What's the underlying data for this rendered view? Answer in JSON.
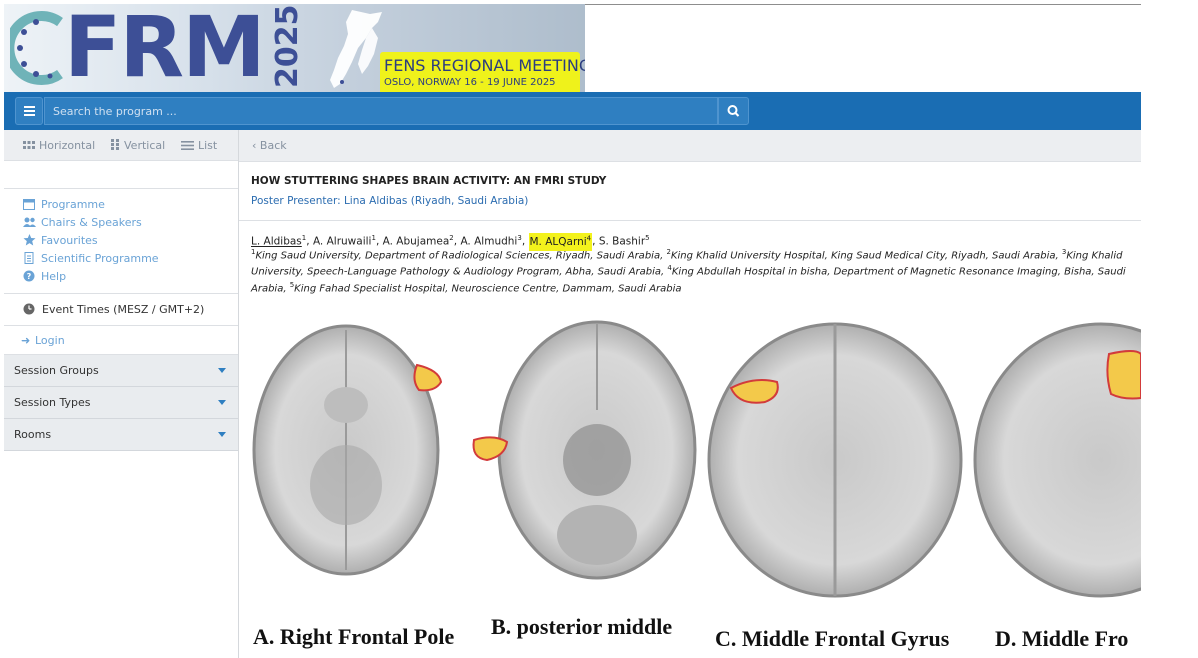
{
  "banner": {
    "logo_text": "FRM",
    "logo_year": "2025",
    "meeting_title": "FENS REGIONAL MEETING",
    "meeting_subtitle": "OSLO, NORWAY 16 - 19 JUNE 2025"
  },
  "search": {
    "placeholder": "Search the program ..."
  },
  "views": {
    "horizontal": "Horizontal",
    "vertical": "Vertical",
    "list": "List"
  },
  "nav": {
    "items": [
      {
        "label": "Programme",
        "icon": "calendar-icon"
      },
      {
        "label": "Chairs & Speakers",
        "icon": "users-icon"
      },
      {
        "label": "Favourites",
        "icon": "star-icon"
      },
      {
        "label": "Scientific Programme",
        "icon": "document-icon"
      },
      {
        "label": "Help",
        "icon": "help-icon"
      }
    ]
  },
  "event_times": "Event Times (MESZ / GMT+2)",
  "login": "Login",
  "accordions": [
    "Session Groups",
    "Session Types",
    "Rooms"
  ],
  "main": {
    "back": "Back",
    "title": "HOW STUTTERING SHAPES BRAIN ACTIVITY: AN FMRI STUDY",
    "presenter": "Poster Presenter: Lina Aldibas (Riyadh, Saudi Arabia)",
    "authors": [
      {
        "name": "L. Aldibas",
        "sup": "1"
      },
      {
        "name": "A. Alruwaili",
        "sup": "1"
      },
      {
        "name": "A. Abujamea",
        "sup": "2"
      },
      {
        "name": "A. Almudhi",
        "sup": "3"
      },
      {
        "name": "M. ALQarni",
        "sup": "4"
      },
      {
        "name": "S. Bashir",
        "sup": "5"
      }
    ],
    "affiliations": [
      {
        "sup": "1",
        "text": "King Saud University, Department of Radiological Sciences, Riyadh, Saudi Arabia, "
      },
      {
        "sup": "2",
        "text": "King Khalid University Hospital, King Saud Medical City, Riyadh, Saudi Arabia, "
      },
      {
        "sup": "3",
        "text": "King Khalid University, Speech-Language Pathology & Audiology Program, Abha, Saudi Arabia, "
      },
      {
        "sup": "4",
        "text": "King Abdullah Hospital in bisha, Department of Magnetic Resonance Imaging, Bisha, Saudi Arabia, "
      },
      {
        "sup": "5",
        "text": "King Fahad Specialist Hospital, Neuroscience Centre, Dammam, Saudi Arabia"
      }
    ],
    "figure_labels": [
      "A. Right Frontal Pole",
      "B. posterior middle",
      "C. Middle Frontal Gyrus",
      "D. Middle Fro"
    ]
  },
  "colors": {
    "nav_blue": "#1a6db3",
    "highlight": "#f3f21c",
    "link": "#6aa3d6"
  }
}
